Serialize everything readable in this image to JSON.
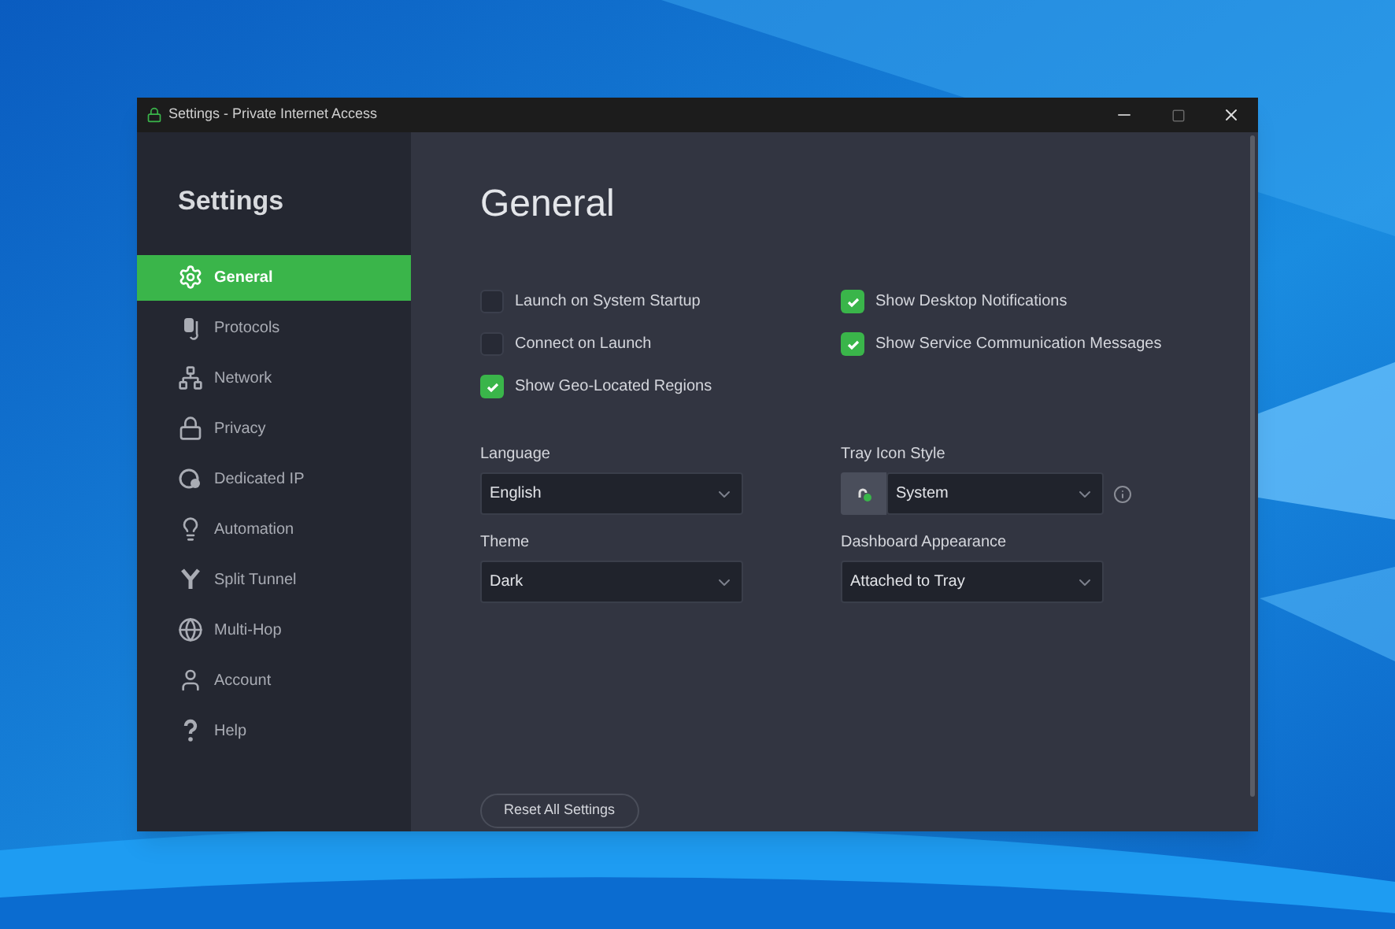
{
  "window": {
    "title": "Settings - Private Internet Access"
  },
  "sidebar": {
    "title": "Settings",
    "items": [
      {
        "label": "General",
        "kind": "gear",
        "selected": true
      },
      {
        "label": "Protocols",
        "kind": "protocols",
        "selected": false
      },
      {
        "label": "Network",
        "kind": "network",
        "selected": false
      },
      {
        "label": "Privacy",
        "kind": "lock",
        "selected": false
      },
      {
        "label": "Dedicated IP",
        "kind": "dip",
        "selected": false
      },
      {
        "label": "Automation",
        "kind": "bulb",
        "selected": false
      },
      {
        "label": "Split Tunnel",
        "kind": "split",
        "selected": false
      },
      {
        "label": "Multi-Hop",
        "kind": "globe",
        "selected": false
      },
      {
        "label": "Account",
        "kind": "user",
        "selected": false
      },
      {
        "label": "Help",
        "kind": "help",
        "selected": false
      }
    ]
  },
  "page": {
    "title": "General",
    "checkboxes_left": [
      {
        "label": "Launch on System Startup",
        "checked": false
      },
      {
        "label": "Connect on Launch",
        "checked": false
      },
      {
        "label": "Show Geo-Located Regions",
        "checked": true
      }
    ],
    "checkboxes_right": [
      {
        "label": "Show Desktop Notifications",
        "checked": true
      },
      {
        "label": "Show Service Communication Messages",
        "checked": true
      }
    ],
    "dropdowns_left": [
      {
        "label": "Language",
        "value": "English"
      },
      {
        "label": "Theme",
        "value": "Dark"
      }
    ],
    "dropdowns_right": [
      {
        "label": "Tray Icon Style",
        "value": "System",
        "kind": "tray"
      },
      {
        "label": "Dashboard Appearance",
        "value": "Attached to Tray",
        "kind": "plain"
      }
    ],
    "reset_button": "Reset All Settings"
  }
}
